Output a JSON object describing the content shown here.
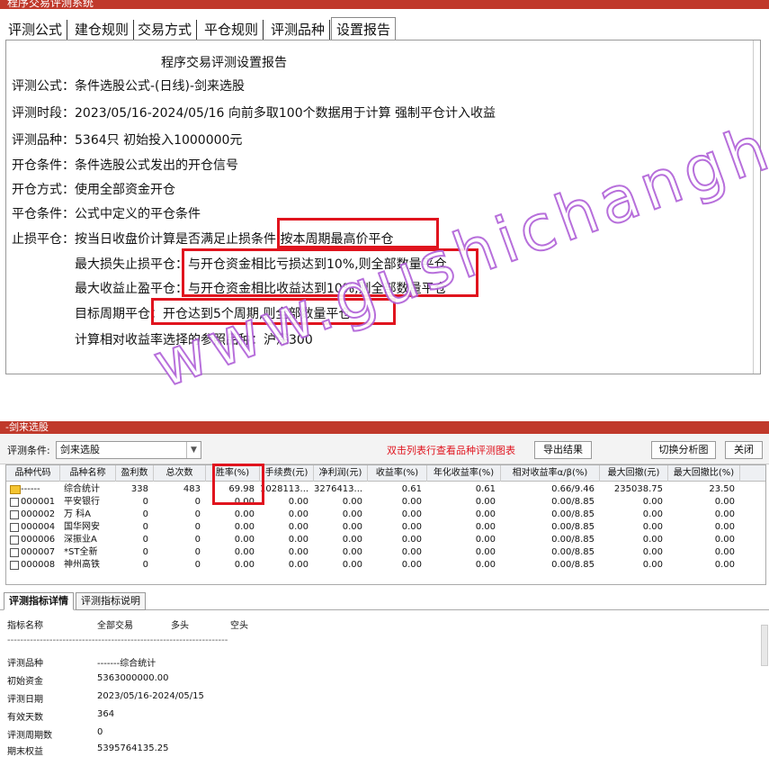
{
  "window": {
    "title": "程序交易评测系统"
  },
  "tabs": [
    "评测公式",
    "建仓规则",
    "交易方式",
    "平仓规则",
    "评测品种",
    "设置报告"
  ],
  "report": {
    "title": "程序交易评测设置报告",
    "lines": [
      "评测公式：条件选股公式-(日线)-剑来选股",
      "评测时段：2023/05/16-2024/05/16 向前多取100个数据用于计算 强制平仓计入收益",
      "评测品种：5364只 初始投入1000000元",
      "开仓条件：条件选股公式发出的开仓信号",
      "开仓方式：使用全部资金开仓",
      "平仓条件：公式中定义的平仓条件",
      "止损平仓：按当日收盘价计算是否满足止损条件,按本周期最高价平仓",
      "最大损失止损平仓：与开仓资金相比亏损达到10%,则全部数量平仓",
      "最大收益止盈平仓：与开仓资金相比收益达到10%,则全部数量平仓",
      "目标周期平仓：开仓达到5个周期,则全部数量平仓",
      "计算相对收益率选择的参照品种：沪深300"
    ]
  },
  "watermark": "www.gushichanghong.com",
  "bottom_panel": {
    "title": "-剑来选股",
    "condition_label": "评测条件:",
    "condition_value": "剑来选股",
    "hint": "双击列表行查看品种评测图表",
    "export_button": "导出结果",
    "switch_button": "切换分析图",
    "close_button": "关闭"
  },
  "table": {
    "columns": [
      "品种代码",
      "品种名称",
      "盈利数",
      "总次数",
      "胜率(%)",
      "手续费(元)",
      "净利润(元)",
      "收益率(%)",
      "年化收益率(%)",
      "相对收益率α/β(%)",
      "最大回撤(元)",
      "最大回撤比(%)"
    ],
    "rows": [
      [
        "------",
        "综合统计",
        "338",
        "483",
        "69.98",
        "1028113....",
        "3276413....",
        "0.61",
        "0.61",
        "0.66/9.46",
        "235038.75",
        "23.50"
      ],
      [
        "000001",
        "平安银行",
        "0",
        "0",
        "0.00",
        "0.00",
        "0.00",
        "0.00",
        "0.00",
        "0.00/8.85",
        "0.00",
        "0.00"
      ],
      [
        "000002",
        "万 科A",
        "0",
        "0",
        "0.00",
        "0.00",
        "0.00",
        "0.00",
        "0.00",
        "0.00/8.85",
        "0.00",
        "0.00"
      ],
      [
        "000004",
        "国华网安",
        "0",
        "0",
        "0.00",
        "0.00",
        "0.00",
        "0.00",
        "0.00",
        "0.00/8.85",
        "0.00",
        "0.00"
      ],
      [
        "000006",
        "深振业A",
        "0",
        "0",
        "0.00",
        "0.00",
        "0.00",
        "0.00",
        "0.00",
        "0.00/8.85",
        "0.00",
        "0.00"
      ],
      [
        "000007",
        "*ST全新",
        "0",
        "0",
        "0.00",
        "0.00",
        "0.00",
        "0.00",
        "0.00",
        "0.00/8.85",
        "0.00",
        "0.00"
      ],
      [
        "000008",
        "神州高铁",
        "0",
        "0",
        "0.00",
        "0.00",
        "0.00",
        "0.00",
        "0.00",
        "0.00/8.85",
        "0.00",
        "0.00"
      ]
    ]
  },
  "detail_tabs": [
    "评测指标详情",
    "评测指标说明"
  ],
  "detail": {
    "headers": [
      "指标名称",
      "全部交易",
      "多头",
      "空头"
    ],
    "separator": "--------------------------------------------------------------------",
    "rows": [
      [
        "评测品种",
        "-------综合统计"
      ],
      [
        "初始资金",
        "5363000000.00"
      ],
      [
        "评测日期",
        "2023/05/16-2024/05/15"
      ],
      [
        "有效天数",
        "364"
      ],
      [
        "评测周期数",
        "0"
      ],
      [
        "期末权益",
        "5395764135.25"
      ]
    ]
  },
  "colors": {
    "titlebar": "#c0392b",
    "highlight_box": "#e0141e",
    "hint_text": "#e0141e",
    "watermark_stroke": "#b060d8"
  }
}
